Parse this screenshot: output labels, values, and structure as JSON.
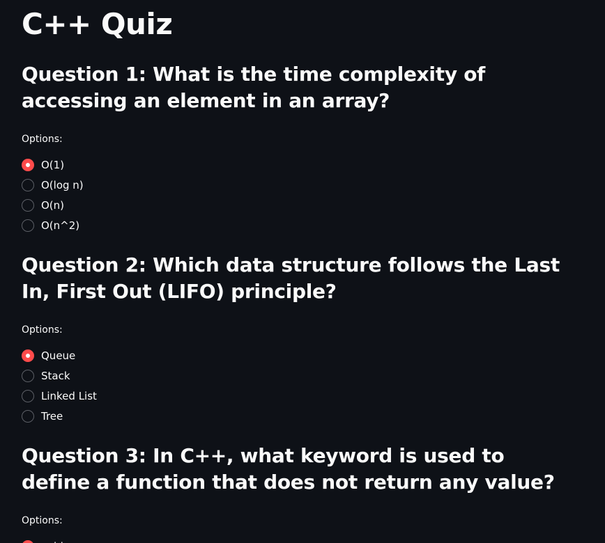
{
  "page": {
    "title": "C++ Quiz"
  },
  "options_label": "Options:",
  "questions": [
    {
      "title": "Question 1: What is the time complexity of accessing an element in an array?",
      "selected_index": 0,
      "options": [
        "O(1)",
        "O(log n)",
        "O(n)",
        "O(n^2)"
      ]
    },
    {
      "title": "Question 2: Which data structure follows the Last In, First Out (LIFO) principle?",
      "selected_index": 0,
      "options": [
        "Queue",
        "Stack",
        "Linked List",
        "Tree"
      ]
    },
    {
      "title": "Question 3: In C++, what keyword is used to define a function that does not return any value?",
      "selected_index": 0,
      "options": [
        "void"
      ]
    }
  ],
  "colors": {
    "background": "#0e1117",
    "text": "#fafafa",
    "accent": "#ff4b4b",
    "radio_border": "#5c5f66"
  }
}
